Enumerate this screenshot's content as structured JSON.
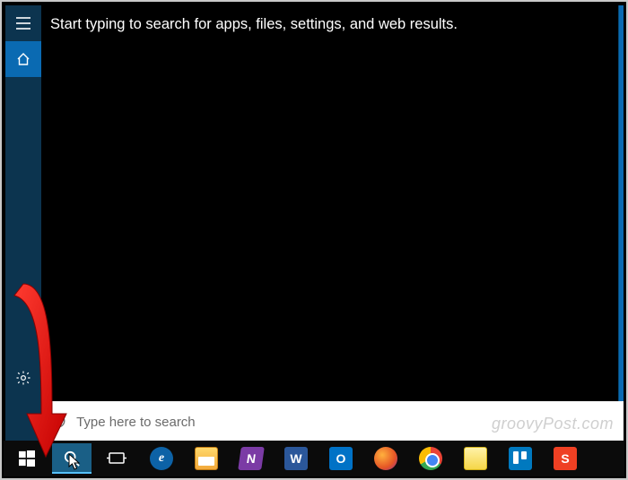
{
  "cortana": {
    "prompt": "Start typing to search for apps, files, settings, and web results.",
    "search_placeholder": "Type here to search"
  },
  "sidebar": {
    "menu_icon": "hamburger-icon",
    "home_icon": "home-icon",
    "settings_icon": "gear-icon"
  },
  "taskbar": {
    "start": "start-icon",
    "cortana": "search-icon",
    "taskview": "task-view-icon",
    "apps": [
      {
        "name": "edge",
        "label": "e"
      },
      {
        "name": "explorer",
        "label": ""
      },
      {
        "name": "onenote",
        "label": "N"
      },
      {
        "name": "word",
        "label": "W"
      },
      {
        "name": "outlook",
        "label": "O"
      },
      {
        "name": "firefox",
        "label": ""
      },
      {
        "name": "chrome",
        "label": ""
      },
      {
        "name": "sticky",
        "label": ""
      },
      {
        "name": "trello",
        "label": ""
      },
      {
        "name": "snagit",
        "label": "S"
      }
    ]
  },
  "watermark": "groovyPost.com",
  "colors": {
    "accent": "#0a6ab2",
    "sidebar": "#0c344f",
    "arrow": "#ff0000"
  }
}
